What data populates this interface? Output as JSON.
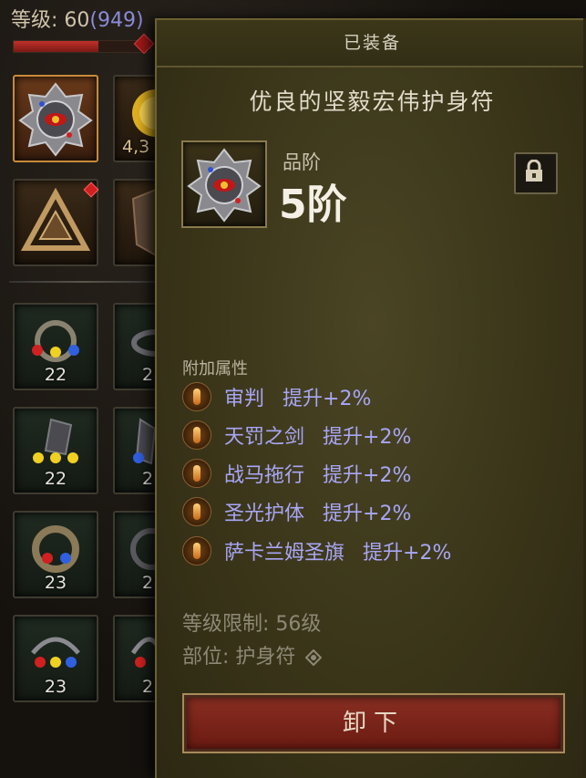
{
  "header": {
    "level_label": "等级: ",
    "level_value": "60",
    "paragon_value": "(949)",
    "hp_fill_fraction": 0.62
  },
  "inventory": {
    "slots": [
      {
        "name": "amulet-slot",
        "count": ""
      },
      {
        "name": "coin-slot",
        "count": "4,3"
      },
      {
        "name": "triangle-emblem-slot",
        "count": ""
      },
      {
        "name": "armor-slot",
        "count": ""
      },
      {
        "name": "gem-ring-slot-1",
        "count": "22"
      },
      {
        "name": "ring-slot-1",
        "count": "2"
      },
      {
        "name": "bracer-slot",
        "count": "22"
      },
      {
        "name": "bracer-slot-2",
        "count": "2"
      },
      {
        "name": "ring-slot-2",
        "count": "23"
      },
      {
        "name": "ring-slot-3",
        "count": "2"
      },
      {
        "name": "earring-slot-1",
        "count": "23"
      },
      {
        "name": "earring-slot-2",
        "count": "2"
      }
    ]
  },
  "tooltip": {
    "header": "已装备",
    "item_name": "优良的坚毅宏伟护身符",
    "grade_label": "品阶",
    "grade_value": "5阶",
    "attributes_title": "附加属性",
    "attributes": [
      {
        "name": "审判",
        "value": "提升+2%",
        "icon": "judgment-icon"
      },
      {
        "name": "天罚之剑",
        "value": "提升+2%",
        "icon": "sword-icon"
      },
      {
        "name": "战马拖行",
        "value": "提升+2%",
        "icon": "horse-icon"
      },
      {
        "name": "圣光护体",
        "value": "提升+2%",
        "icon": "holy-shield-icon"
      },
      {
        "name": "萨卡兰姆圣旗",
        "value": "提升+2%",
        "icon": "banner-icon"
      }
    ],
    "level_requirement": "等级限制: 56级",
    "slot_label": "部位: 护身符",
    "unequip_label": "卸下"
  },
  "colors": {
    "attribute_text": "#a8a6f6",
    "tooltip_bg": "#3a3519",
    "button_red": "#8a2e22",
    "selected_slot": "#c88a3a"
  }
}
